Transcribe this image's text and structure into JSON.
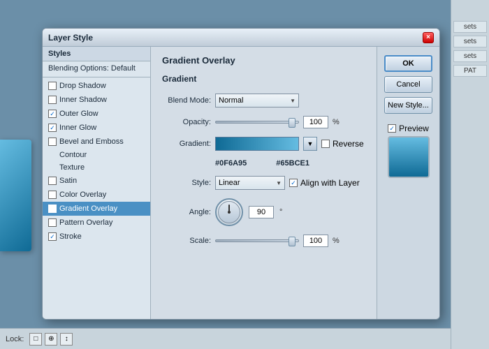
{
  "dialog": {
    "title": "Layer Style",
    "close_label": "×"
  },
  "styles_panel": {
    "header": "Styles",
    "blending_options": "Blending Options: Default",
    "items": [
      {
        "id": "drop-shadow",
        "label": "Drop Shadow",
        "checked": false,
        "active": false
      },
      {
        "id": "inner-shadow",
        "label": "Inner Shadow",
        "checked": false,
        "active": false
      },
      {
        "id": "outer-glow",
        "label": "Outer Glow",
        "checked": true,
        "active": false
      },
      {
        "id": "inner-glow",
        "label": "Inner Glow",
        "checked": true,
        "active": false
      },
      {
        "id": "bevel-emboss",
        "label": "Bevel and Emboss",
        "checked": false,
        "active": false
      },
      {
        "id": "contour",
        "label": "Contour",
        "checked": false,
        "active": false,
        "sub": true
      },
      {
        "id": "texture",
        "label": "Texture",
        "checked": false,
        "active": false,
        "sub": true
      },
      {
        "id": "satin",
        "label": "Satin",
        "checked": false,
        "active": false
      },
      {
        "id": "color-overlay",
        "label": "Color Overlay",
        "checked": false,
        "active": false
      },
      {
        "id": "gradient-overlay",
        "label": "Gradient Overlay",
        "checked": true,
        "active": true
      },
      {
        "id": "pattern-overlay",
        "label": "Pattern Overlay",
        "checked": false,
        "active": false
      },
      {
        "id": "stroke",
        "label": "Stroke",
        "checked": true,
        "active": false
      }
    ]
  },
  "gradient_overlay": {
    "section_title": "Gradient Overlay",
    "subsection_title": "Gradient",
    "blend_mode_label": "Blend Mode:",
    "blend_mode_value": "Normal",
    "opacity_label": "Opacity:",
    "opacity_value": "100",
    "opacity_unit": "%",
    "gradient_label": "Gradient:",
    "gradient_color_start": "#0F6A95",
    "gradient_color_end": "#65BCE1",
    "reverse_label": "Reverse",
    "reverse_checked": false,
    "style_label": "Style:",
    "style_value": "Linear",
    "align_layer_label": "Align with Layer",
    "align_layer_checked": true,
    "angle_label": "Angle:",
    "angle_value": "90",
    "angle_unit": "°",
    "scale_label": "Scale:",
    "scale_value": "100",
    "scale_unit": "%"
  },
  "buttons": {
    "ok_label": "OK",
    "cancel_label": "Cancel",
    "new_style_label": "New Style...",
    "preview_label": "Preview",
    "preview_checked": true
  },
  "bottom_bar": {
    "lock_label": "Lock:",
    "icons": [
      "□",
      "⊕",
      "↕"
    ]
  },
  "right_panel": {
    "items": [
      "sets",
      "sets",
      "sets",
      "PAT"
    ]
  }
}
